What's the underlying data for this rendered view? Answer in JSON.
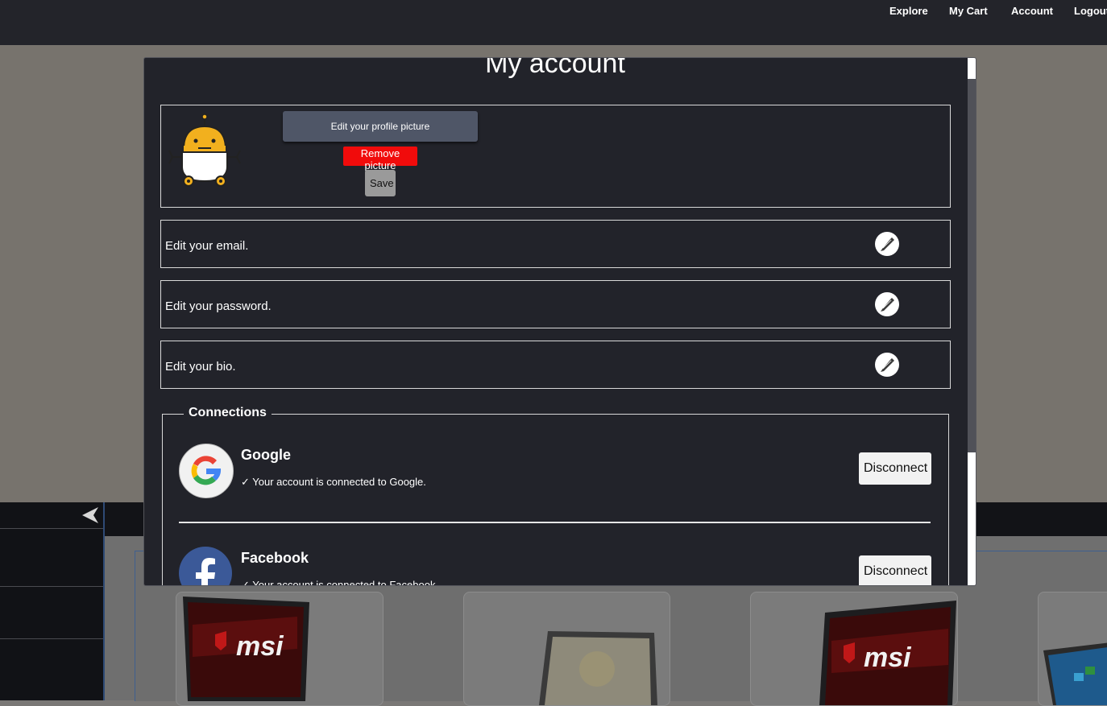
{
  "nav": {
    "links": [
      "Explore",
      "My Cart",
      "Account",
      "Logout"
    ]
  },
  "modal": {
    "title": "My account",
    "profile": {
      "edit_picture_label": "Edit your profile picture",
      "remove_picture_label": "Remove picture",
      "save_label": "Save"
    },
    "edit_rows": [
      {
        "label": "Edit your email."
      },
      {
        "label": "Edit your password."
      },
      {
        "label": "Edit your bio."
      }
    ],
    "connections": {
      "legend": "Connections",
      "items": [
        {
          "name": "Google",
          "status": "✓ Your account is connected to Google.",
          "button": "Disconnect"
        },
        {
          "name": "Facebook",
          "status": "✓ Your account is connected to Facebook.",
          "button": "Disconnect"
        }
      ]
    }
  },
  "background": {
    "product_brands": [
      "msi",
      "msi"
    ]
  },
  "colors": {
    "nav_bg": "#23242a",
    "modal_bg": "#22232a",
    "edit_picture_button": "#4f5667",
    "remove_button": "#f10b0b",
    "save_button": "#9a9a9a"
  },
  "icons": [
    "pencil-icon",
    "google-logo",
    "facebook-logo",
    "robot-avatar",
    "collapse-arrow-icon"
  ]
}
